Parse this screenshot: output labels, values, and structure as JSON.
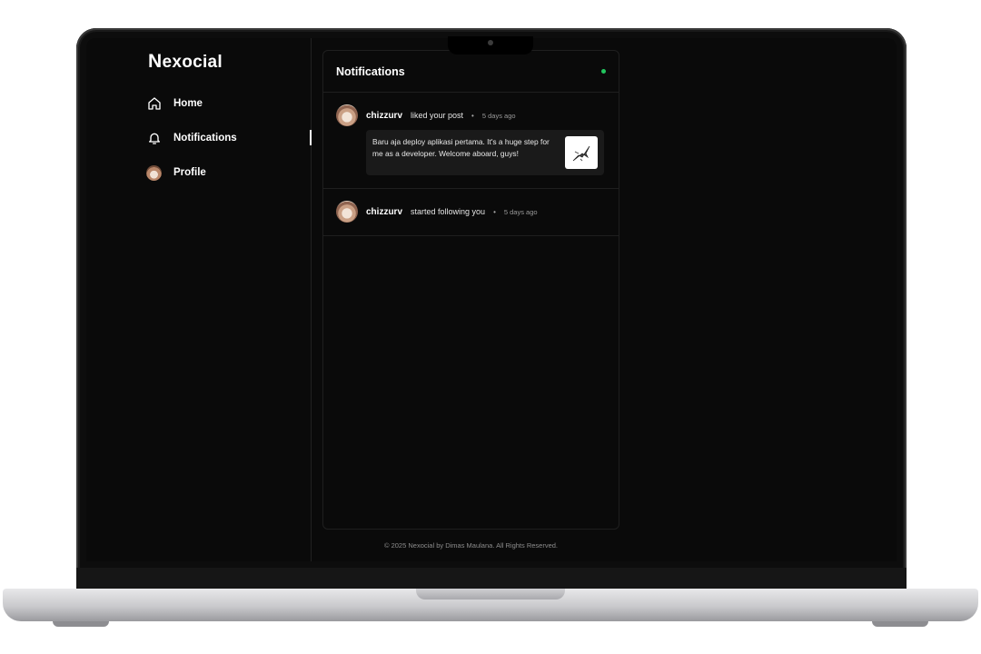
{
  "app": {
    "logo_initial": "N",
    "logo_rest": "exocial"
  },
  "sidebar": {
    "items": [
      {
        "label": "Home",
        "icon": "home-icon"
      },
      {
        "label": "Notifications",
        "icon": "bell-icon",
        "active": true
      },
      {
        "label": "Profile",
        "icon": "avatar"
      }
    ]
  },
  "notifications": {
    "title": "Notifications",
    "status_color": "#22c55e",
    "items": [
      {
        "username": "chizzurv",
        "action": "liked your post",
        "separator": "•",
        "time": "5 days ago",
        "post_text": "Baru aja deploy aplikasi pertama. It's a huge step for me as a developer. Welcome aboard, guys!"
      },
      {
        "username": "chizzurv",
        "action": "started following you",
        "separator": "•",
        "time": "5 days ago"
      }
    ]
  },
  "footer": {
    "text": "© 2025 Nexocial by Dimas Maulana. All Rights Reserved."
  },
  "colors": {
    "background": "#0a0a0a",
    "border": "#1f1f1f",
    "text": "#ffffff",
    "online": "#22c55e"
  }
}
